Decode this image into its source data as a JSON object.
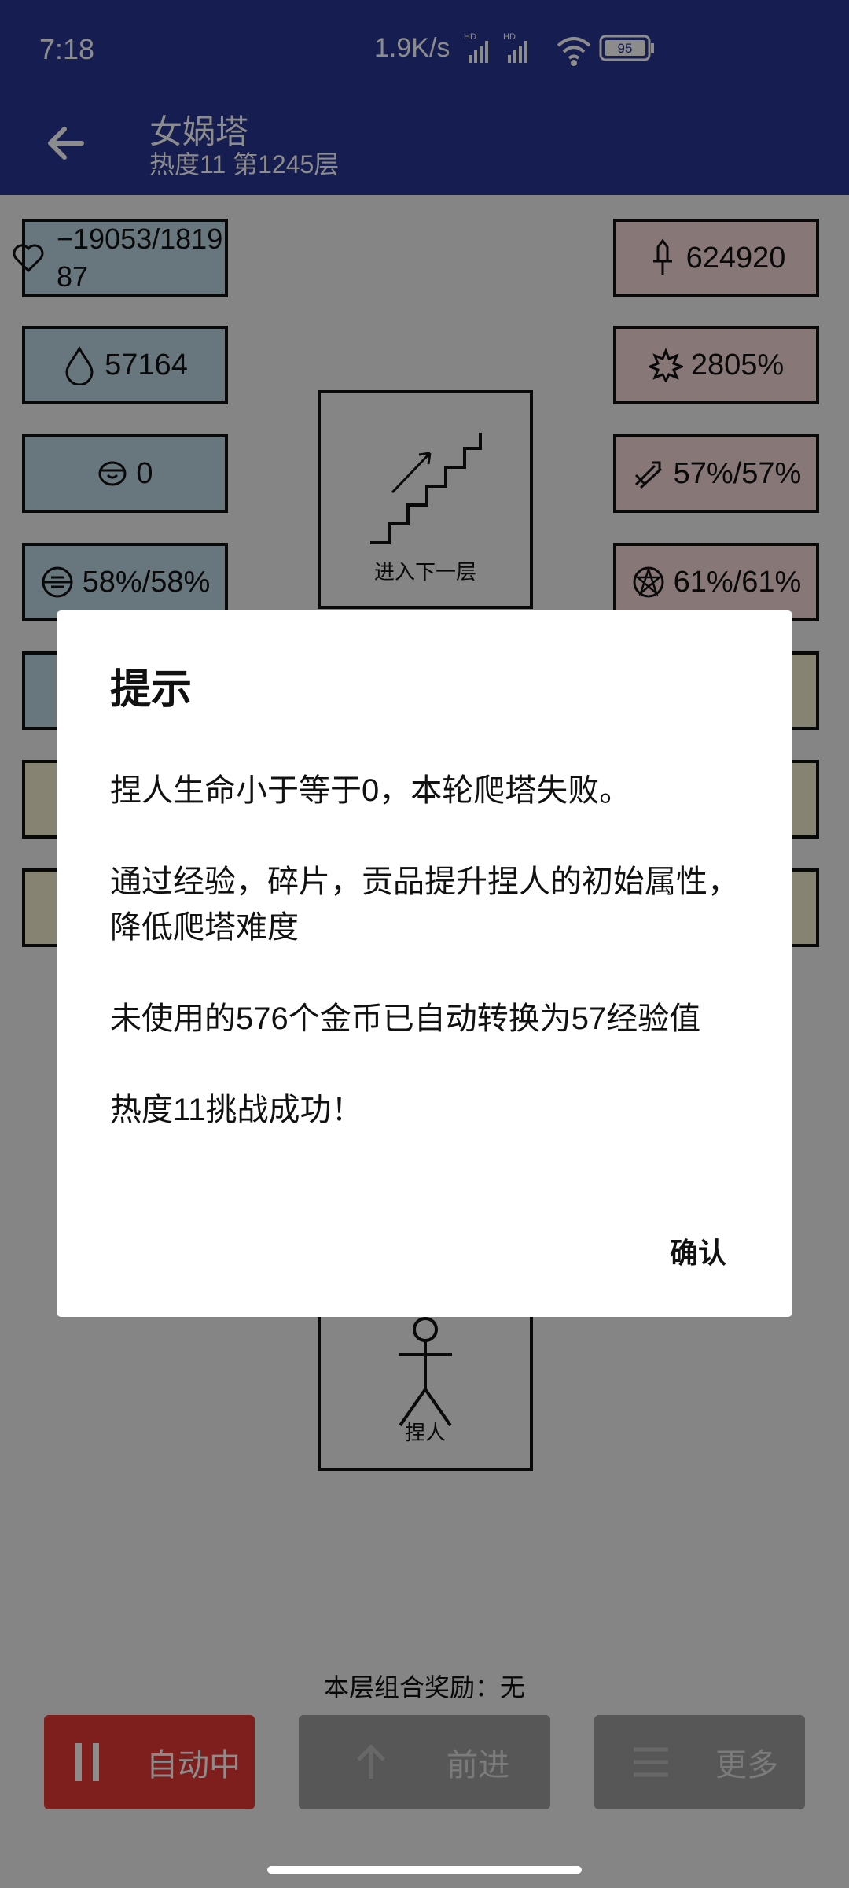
{
  "status_bar": {
    "time": "7:18",
    "network_speed": "1.9K/s",
    "battery": "95"
  },
  "app_bar": {
    "title": "女娲塔",
    "subtitle": "热度11 第1245层"
  },
  "stats_left": [
    {
      "icon": "heart-icon",
      "value": "−19053/181987"
    },
    {
      "icon": "drop-icon",
      "value": "57164"
    },
    {
      "icon": "helmet-icon",
      "value": "0"
    },
    {
      "icon": "target-icon",
      "value": "58%/58%"
    }
  ],
  "stats_right": [
    {
      "icon": "sword-icon",
      "value": "624920"
    },
    {
      "icon": "burst-icon",
      "value": "2805%"
    },
    {
      "icon": "crit-icon",
      "value": "57%/57%"
    },
    {
      "icon": "pentagram-icon",
      "value": "61%/61%"
    }
  ],
  "stairs_box": {
    "label": "进入下一层"
  },
  "player_box": {
    "label": "捏人"
  },
  "bottom": {
    "combo_reward": "本层组合奖励：无",
    "auto_label": "自动中",
    "forward_label": "前进",
    "more_label": "更多"
  },
  "dialog": {
    "title": "提示",
    "paragraphs": [
      "捏人生命小于等于0，本轮爬塔失败。",
      "通过经验，碎片，贡品提升捏人的初始属性，降低爬塔难度",
      "未使用的576个金币已自动转换为57经验值",
      "热度11挑战成功！"
    ],
    "confirm_label": "确认"
  },
  "colors": {
    "app_bar": "#283593",
    "stat_blue": "#bed8e6",
    "stat_pink": "#f6d9d9",
    "stat_tan": "#f4efcf",
    "auto_button": "#e53935"
  }
}
